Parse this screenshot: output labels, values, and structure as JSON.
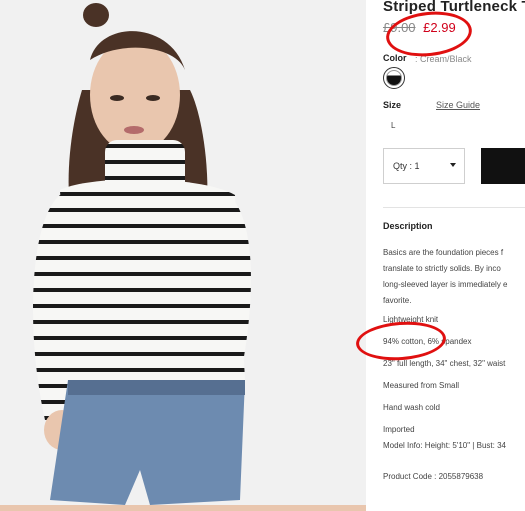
{
  "product": {
    "title": "Striped Turtleneck Top",
    "price_original": "£9.00",
    "price_sale": "£2.99"
  },
  "color": {
    "label": "Color",
    "value": ": Cream/Black"
  },
  "size": {
    "label": "Size",
    "guide_link": "Size Guide",
    "options": [
      "L"
    ]
  },
  "quantity": {
    "label": "Qty : 1"
  },
  "description": {
    "heading": "Description",
    "lines": [
      "Basics are the foundation pieces f",
      "translate to strictly solids. By inco",
      "long-sleeved layer is immediately e",
      "favorite.",
      "Lightweight knit",
      "94% cotton, 6% spandex",
      "23\" full length, 34\" chest, 32\" waist",
      "Measured from Small",
      "Hand wash cold",
      "Imported",
      "Model Info: Height: 5'10\" | Bust: 34"
    ],
    "product_code": "Product Code : 2055879638"
  },
  "annotations": {
    "ring_color": "#e01010"
  }
}
